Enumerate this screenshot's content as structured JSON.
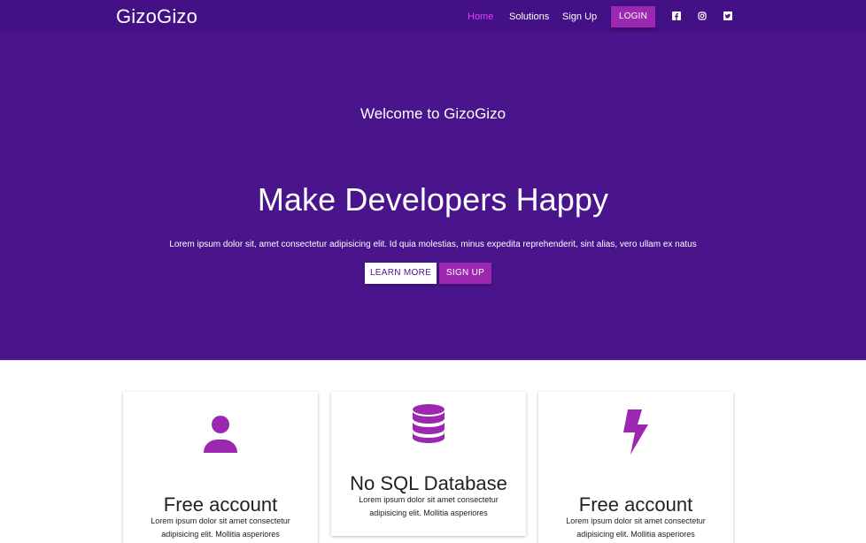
{
  "brand": {
    "name": "GizoGizo"
  },
  "nav": {
    "links": [
      {
        "label": "Home"
      },
      {
        "label": "Solutions"
      },
      {
        "label": "Sign Up"
      }
    ],
    "login_label": "LOGIN",
    "social_icons": [
      "facebook-icon",
      "instagram-icon",
      "twitter-icon"
    ]
  },
  "hero": {
    "welcome": "Welcome to GizoGizo",
    "headline": "Make Developers Happy",
    "lead": "Lorem ipsum dolor sit, amet consectetur adipisicing elit. Id quia molestias, minus expedita reprehenderit, sint alias, vero ullam ex natus",
    "primary_button": "LEARN MORE",
    "secondary_button": "SIGN UP"
  },
  "features": [
    {
      "icon": "user-icon",
      "title": "Free account",
      "text": "Lorem ipsum dolor sit amet consectetur adipisicing elit. Mollitia asperiores"
    },
    {
      "icon": "database-icon",
      "title": "No SQL Database",
      "text": "Lorem ipsum dolor sit amet consectetur adipisicing elit. Mollitia asperiores"
    },
    {
      "icon": "lightning-icon",
      "title": "Free account",
      "text": "Lorem ipsum dolor sit amet consectetur adipisicing elit. Mollitia asperiores"
    }
  ],
  "colors": {
    "primary": "#4a148c",
    "navbar": "#441086",
    "accent": "#9c27b0",
    "active_link": "#e040fb"
  }
}
